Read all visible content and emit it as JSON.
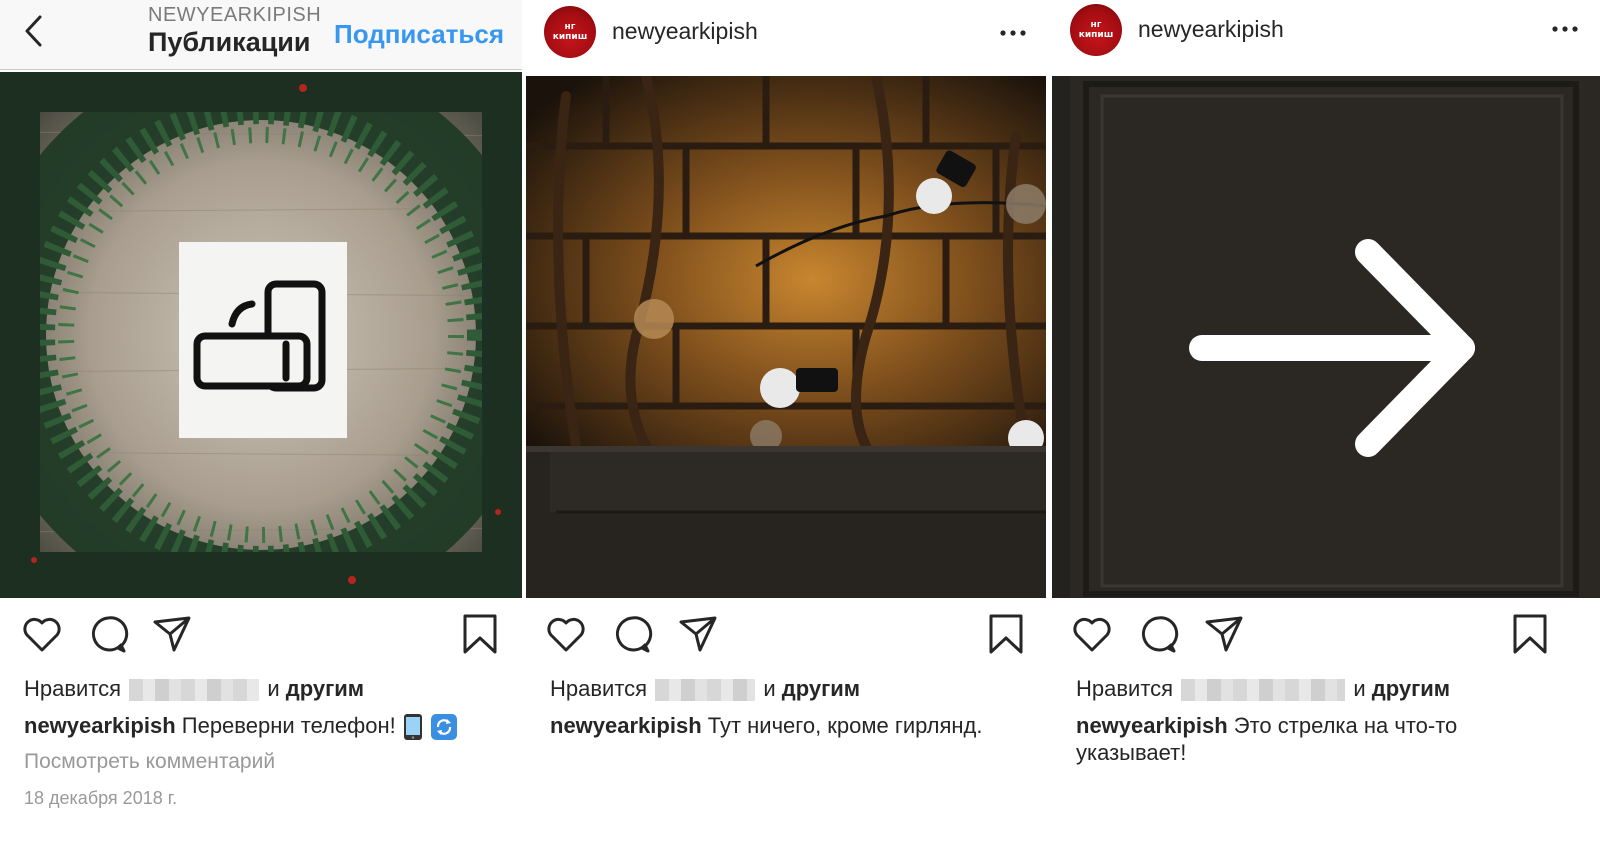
{
  "panel1": {
    "header_username": "NEWYEARKIPISH",
    "header_title": "Публикации",
    "follow_label": "Подписаться",
    "likes_prefix": "Нравится",
    "likes_suffix": "и",
    "likes_others": "другим",
    "caption_user": "newyearkipish",
    "caption_text": "Переверни телефон!",
    "view_comments": "Посмотреть комментарий",
    "date": "18 декабря 2018 г."
  },
  "panel2": {
    "username": "newyearkipish",
    "likes_prefix": "Нравится",
    "likes_suffix": "и",
    "likes_others": "другим",
    "caption_user": "newyearkipish",
    "caption_text": "Тут ничего, кроме гирлянд."
  },
  "panel3": {
    "username": "newyearkipish",
    "likes_prefix": "Нравится",
    "likes_suffix": "и",
    "likes_others": "другим",
    "caption_user": "newyearkipish",
    "caption_text": "Это стрелка на что-то указывает!"
  },
  "avatar": {
    "line1": "нг",
    "line2": "кипиш"
  },
  "icons": [
    "back-chevron-icon",
    "more-dots-icon",
    "heart-icon",
    "comment-icon",
    "share-icon",
    "bookmark-icon",
    "mobile-phone-emoji",
    "rotate-arrows-emoji"
  ],
  "colors": {
    "link": "#3897f0",
    "text": "#262626",
    "muted": "#999999",
    "avatar": "#c7151b"
  }
}
